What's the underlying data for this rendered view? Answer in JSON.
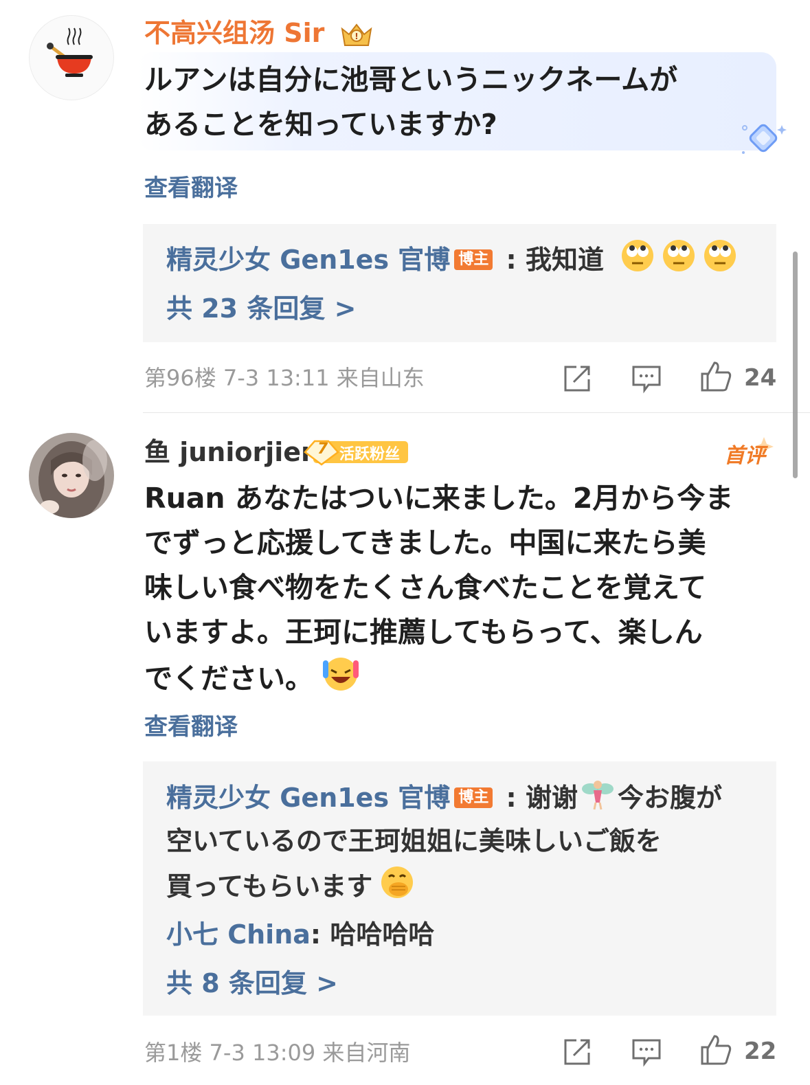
{
  "comments": [
    {
      "username": "不高兴组汤 Sir",
      "text_lines": [
        "ルアンは自分に池哥というニックネームが",
        "あることを知っていますか?"
      ],
      "translate_label": "查看翻译",
      "reply": {
        "author": "精灵少女 Gen1es 官博",
        "blogger_tag": "博主",
        "separator": " : ",
        "text": "我知道",
        "emoji": "rolling-eyes-face ×3"
      },
      "reply_count": "共 23 条回复 >",
      "meta": "第96楼  7-3 13:11  来自山东",
      "like_count": "24"
    },
    {
      "username": "鱼 juniorjier",
      "fan_badge_level": "7",
      "fan_badge_label": "活跃粉丝",
      "first_review_label": "首评",
      "text_lines": [
        "Ruan あなたはついに来ました。2月から今ま",
        "でずっと応援してきました。中国に来たら美",
        "味しい食べ物をたくさん食べたことを覚えて",
        "いますよ。王珂に推薦してもらって、楽しん",
        "でください。"
      ],
      "translate_label": "查看翻译",
      "reply": {
        "author": "精灵少女 Gen1es 官博",
        "blogger_tag": "博主",
        "separator": " : ",
        "text_line1": "谢谢",
        "text_line1b": "今お腹が",
        "text_line2": "空いているので王珂姐姐に美味しいご飯を",
        "text_line3": "買ってもらいます"
      },
      "sub_reply": {
        "author": "小七 China",
        "separator": ": ",
        "text": "哈哈哈哈"
      },
      "reply_count": "共 8 条回复 >",
      "meta": "第1楼  7-3 13:09  来自河南",
      "like_count": "22"
    }
  ],
  "icons": {
    "share": "share-icon",
    "comment": "comment-icon",
    "like": "thumbs-up-icon"
  },
  "colors": {
    "orange_username": "#ee7634",
    "link_blue": "#4a6f9c",
    "meta_gray": "#9a9a9a",
    "reply_bg": "#f5f5f5"
  }
}
